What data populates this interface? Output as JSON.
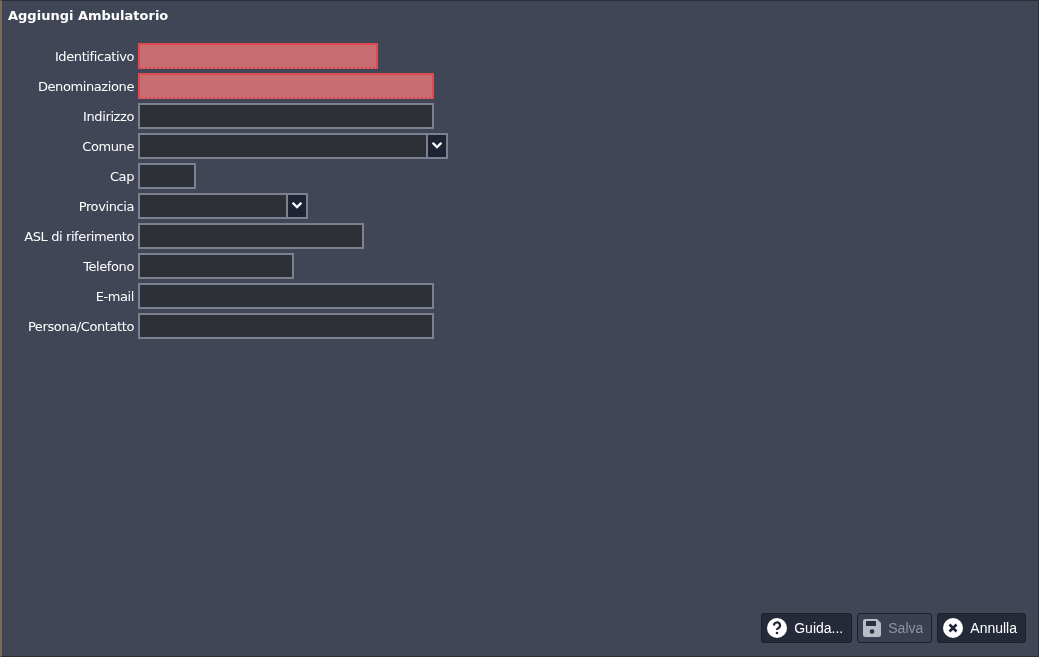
{
  "window": {
    "title": "Aggiungi Ambulatorio"
  },
  "fields": [
    {
      "label": "Identificativo",
      "kind": "text",
      "invalid": true
    },
    {
      "label": "Denominazione",
      "kind": "text",
      "invalid": true
    },
    {
      "label": "Indirizzo",
      "kind": "text",
      "invalid": false
    },
    {
      "label": "Comune",
      "kind": "select",
      "invalid": false
    },
    {
      "label": "Cap",
      "kind": "text",
      "invalid": false
    },
    {
      "label": "Provincia",
      "kind": "select",
      "invalid": false
    },
    {
      "label": "ASL di riferimento",
      "kind": "text",
      "invalid": false
    },
    {
      "label": "Telefono",
      "kind": "text",
      "invalid": false
    },
    {
      "label": "E-mail",
      "kind": "text",
      "invalid": false
    },
    {
      "label": "Persona/Contatto",
      "kind": "text",
      "invalid": false
    }
  ],
  "buttons": [
    {
      "label": "Guida...",
      "kind": "help",
      "disabled": false
    },
    {
      "label": "Salva",
      "kind": "save",
      "disabled": true
    },
    {
      "label": "Annulla",
      "kind": "cancel",
      "disabled": false
    }
  ]
}
